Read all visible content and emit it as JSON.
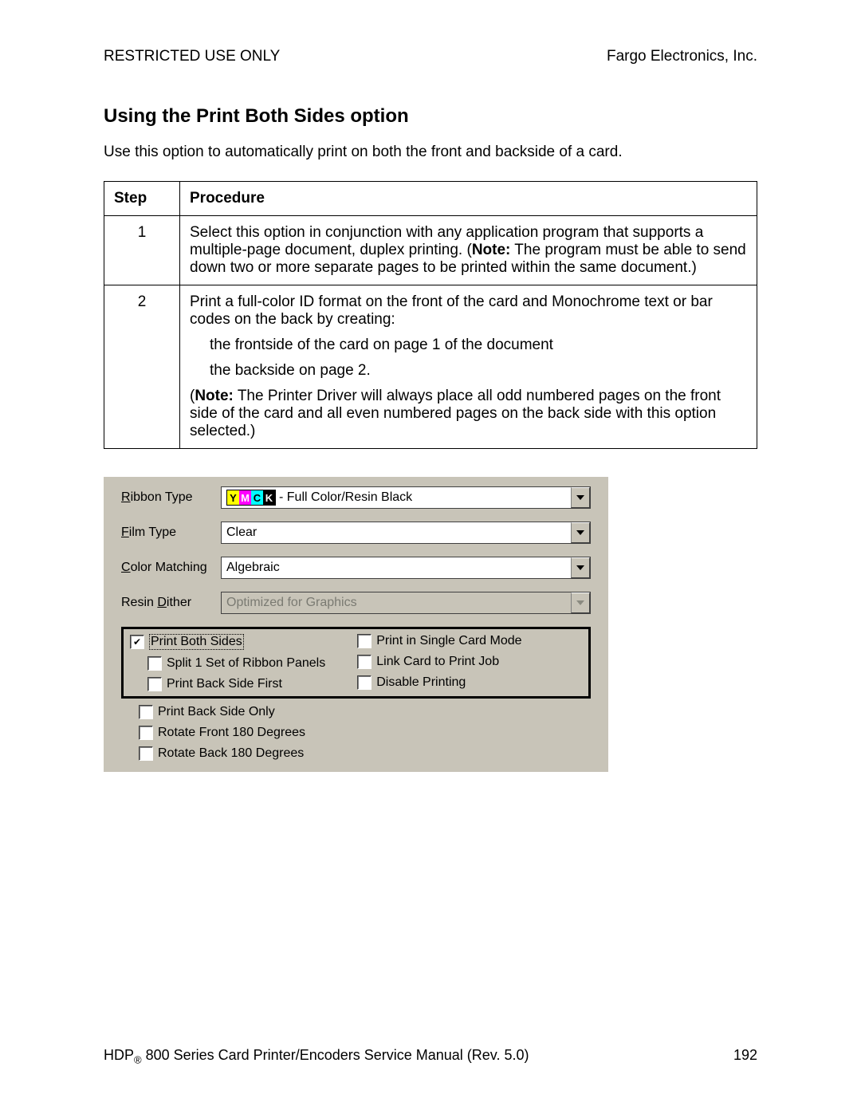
{
  "header": {
    "left": "RESTRICTED USE ONLY",
    "right": "Fargo Electronics, Inc."
  },
  "section": {
    "title": "Using the Print Both Sides option",
    "intro": "Use this option to automatically print on both the front and backside of a card."
  },
  "table": {
    "head": {
      "step": "Step",
      "procedure": "Procedure"
    },
    "rows": [
      {
        "num": "1",
        "p1a": "Select this option in conjunction with any application program that supports a multiple-page document, duplex printing. (",
        "note": "Note:",
        "p1b": "  The program must be able to send down two or more separate pages to be printed within the same document.)"
      },
      {
        "num": "2",
        "p1": "Print a full-color ID format on the front of the card and Monochrome text or bar codes on the back by creating:",
        "li1": "the frontside of the card on page 1 of the document",
        "li2": "the backside on page 2.",
        "p2a": "(",
        "note": "Note:",
        "p2b": "  The Printer Driver will always place all odd numbered pages on the front side of the card and all even numbered pages on the back side with this option selected.)"
      }
    ]
  },
  "dialog": {
    "labels": {
      "ribbon_pre": "R",
      "ribbon_rest": "ibbon Type",
      "film_pre": "F",
      "film_rest": "ilm Type",
      "color_pre": "C",
      "color_rest": "olor Matching",
      "dither_pre1": "Resin ",
      "dither_u": "D",
      "dither_rest": "ither"
    },
    "values": {
      "ribbon_suffix": " - Full Color/Resin Black",
      "film": "Clear",
      "color": "Algebraic",
      "dither": "Optimized for Graphics"
    },
    "checks": {
      "print_both_pre": "P",
      "print_both_rest": "rint Both Sides",
      "split_pre": "S",
      "split_rest": "plit 1 Set of Ribbon Panels",
      "back_first_pre": "Print Back Side ",
      "back_first_u": "F",
      "back_first_rest": "irst",
      "single_mode": "Print in Single Card Mode",
      "link_card": "Link Card to Print Job",
      "disable_pre": "D",
      "disable_rest": "isable Printing",
      "back_only_pre": "Print ",
      "back_only_u": "B",
      "back_only_rest": "ack Side Only",
      "rot_front_pre": "Rotat",
      "rot_front_u": "e",
      "rot_front_rest": " Front 180 Degrees",
      "rot_back_pre": "Rot",
      "rot_back_u": "a",
      "rot_back_rest": "te Back 180 Degrees"
    },
    "ymck": {
      "y": "Y",
      "m": "M",
      "c": "C",
      "k": "K"
    }
  },
  "footer": {
    "left_a": "HDP",
    "left_b": " 800 Series Card Printer/Encoders Service Manual (Rev. 5.0)",
    "page": "192"
  }
}
